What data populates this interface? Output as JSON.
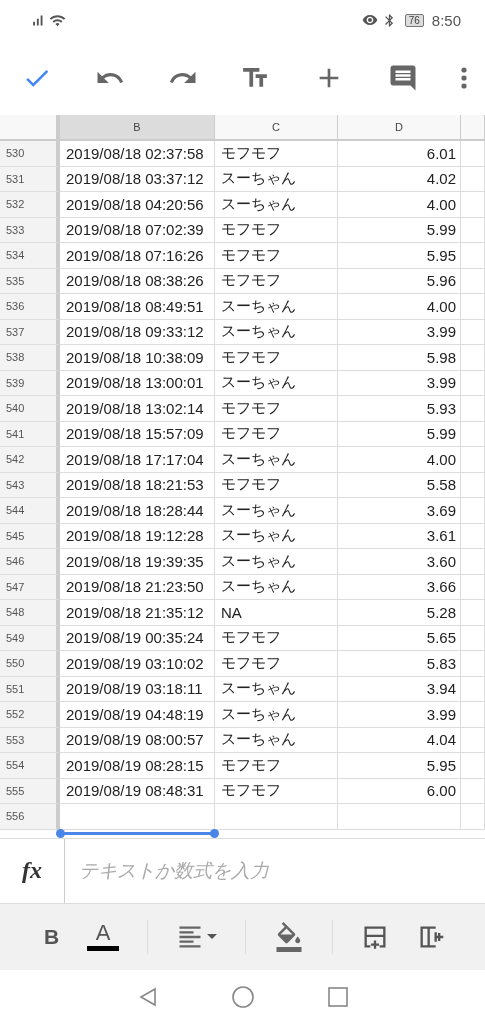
{
  "status_bar": {
    "battery": "76",
    "time": "8:50"
  },
  "sheet": {
    "columns": [
      {
        "label": "B",
        "selected": true
      },
      {
        "label": "C",
        "selected": false
      },
      {
        "label": "D",
        "selected": false
      }
    ],
    "rows": [
      {
        "number": "530",
        "cells": [
          "2019/08/18 02:37:58",
          "モフモフ",
          "6.01"
        ]
      },
      {
        "number": "531",
        "cells": [
          "2019/08/18 03:37:12",
          "スーちゃん",
          "4.02"
        ]
      },
      {
        "number": "532",
        "cells": [
          "2019/08/18 04:20:56",
          "スーちゃん",
          "4.00"
        ]
      },
      {
        "number": "533",
        "cells": [
          "2019/08/18 07:02:39",
          "モフモフ",
          "5.99"
        ]
      },
      {
        "number": "534",
        "cells": [
          "2019/08/18 07:16:26",
          "モフモフ",
          "5.95"
        ]
      },
      {
        "number": "535",
        "cells": [
          "2019/08/18 08:38:26",
          "モフモフ",
          "5.96"
        ]
      },
      {
        "number": "536",
        "cells": [
          "2019/08/18 08:49:51",
          "スーちゃん",
          "4.00"
        ]
      },
      {
        "number": "537",
        "cells": [
          "2019/08/18 09:33:12",
          "スーちゃん",
          "3.99"
        ]
      },
      {
        "number": "538",
        "cells": [
          "2019/08/18 10:38:09",
          "モフモフ",
          "5.98"
        ]
      },
      {
        "number": "539",
        "cells": [
          "2019/08/18 13:00:01",
          "スーちゃん",
          "3.99"
        ]
      },
      {
        "number": "540",
        "cells": [
          "2019/08/18 13:02:14",
          "モフモフ",
          "5.93"
        ]
      },
      {
        "number": "541",
        "cells": [
          "2019/08/18 15:57:09",
          "モフモフ",
          "5.99"
        ]
      },
      {
        "number": "542",
        "cells": [
          "2019/08/18 17:17:04",
          "スーちゃん",
          "4.00"
        ]
      },
      {
        "number": "543",
        "cells": [
          "2019/08/18 18:21:53",
          "モフモフ",
          "5.58"
        ]
      },
      {
        "number": "544",
        "cells": [
          "2019/08/18 18:28:44",
          "スーちゃん",
          "3.69"
        ]
      },
      {
        "number": "545",
        "cells": [
          "2019/08/18 19:12:28",
          "スーちゃん",
          "3.61"
        ]
      },
      {
        "number": "546",
        "cells": [
          "2019/08/18 19:39:35",
          "スーちゃん",
          "3.60"
        ]
      },
      {
        "number": "547",
        "cells": [
          "2019/08/18 21:23:50",
          "スーちゃん",
          "3.66"
        ]
      },
      {
        "number": "548",
        "cells": [
          "2019/08/18 21:35:12",
          "NA",
          "5.28"
        ]
      },
      {
        "number": "549",
        "cells": [
          "2019/08/19 00:35:24",
          "モフモフ",
          "5.65"
        ]
      },
      {
        "number": "550",
        "cells": [
          "2019/08/19 03:10:02",
          "モフモフ",
          "5.83"
        ]
      },
      {
        "number": "551",
        "cells": [
          "2019/08/19 03:18:11",
          "スーちゃん",
          "3.94"
        ]
      },
      {
        "number": "552",
        "cells": [
          "2019/08/19 04:48:19",
          "スーちゃん",
          "3.99"
        ]
      },
      {
        "number": "553",
        "cells": [
          "2019/08/19 08:00:57",
          "スーちゃん",
          "4.04"
        ]
      },
      {
        "number": "554",
        "cells": [
          "2019/08/19 08:28:15",
          "モフモフ",
          "5.95"
        ]
      },
      {
        "number": "555",
        "cells": [
          "2019/08/19 08:48:31",
          "モフモフ",
          "6.00"
        ]
      },
      {
        "number": "556",
        "cells": []
      }
    ]
  },
  "formula_bar": {
    "label": "fx",
    "placeholder": "テキストか数式を入力"
  },
  "format_toolbar": {
    "bold": "B",
    "text_color": "A"
  }
}
